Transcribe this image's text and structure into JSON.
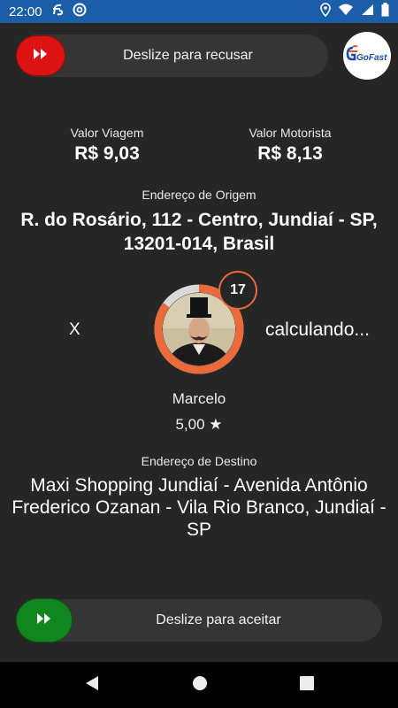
{
  "status_bar": {
    "time": "22:00",
    "icons_left": [
      "gofast-notification-icon",
      "at-sign-icon"
    ],
    "icons_right": [
      "location-icon",
      "wifi-icon",
      "signal-icon",
      "battery-icon"
    ],
    "color": "#1a5ea8"
  },
  "reject_slider": {
    "label": "Deslize para recusar",
    "handle_color": "#dd1212",
    "icon": "fast-forward-icon"
  },
  "logo": {
    "text": "GoFast"
  },
  "trip_values": {
    "trip_label": "Valor Viagem",
    "trip_value": "R$ 9,03",
    "driver_label": "Valor Motorista",
    "driver_value": "R$ 8,13"
  },
  "origin": {
    "label": "Endereço de Origem",
    "address": "R. do Rosário, 112 - Centro, Jundiaí - SP, 13201-014, Brasil"
  },
  "distance": {
    "x_label": "X",
    "status": "calculando..."
  },
  "countdown": {
    "seconds": "17",
    "ring_progress": 0.85,
    "ring_color": "#ea6a3a"
  },
  "passenger": {
    "name": "Marcelo",
    "rating": "5,00 ★"
  },
  "destination": {
    "label": "Endereço de Destino",
    "address": "Maxi Shopping Jundiaí - Avenida Antônio Frederico Ozanan - Vila Rio Branco, Jundiaí - SP"
  },
  "accept_slider": {
    "label": "Deslize para aceitar",
    "handle_color": "#12861e",
    "icon": "fast-forward-icon"
  },
  "nav_bar": {
    "buttons": [
      "back-icon",
      "home-icon",
      "recents-icon"
    ]
  }
}
